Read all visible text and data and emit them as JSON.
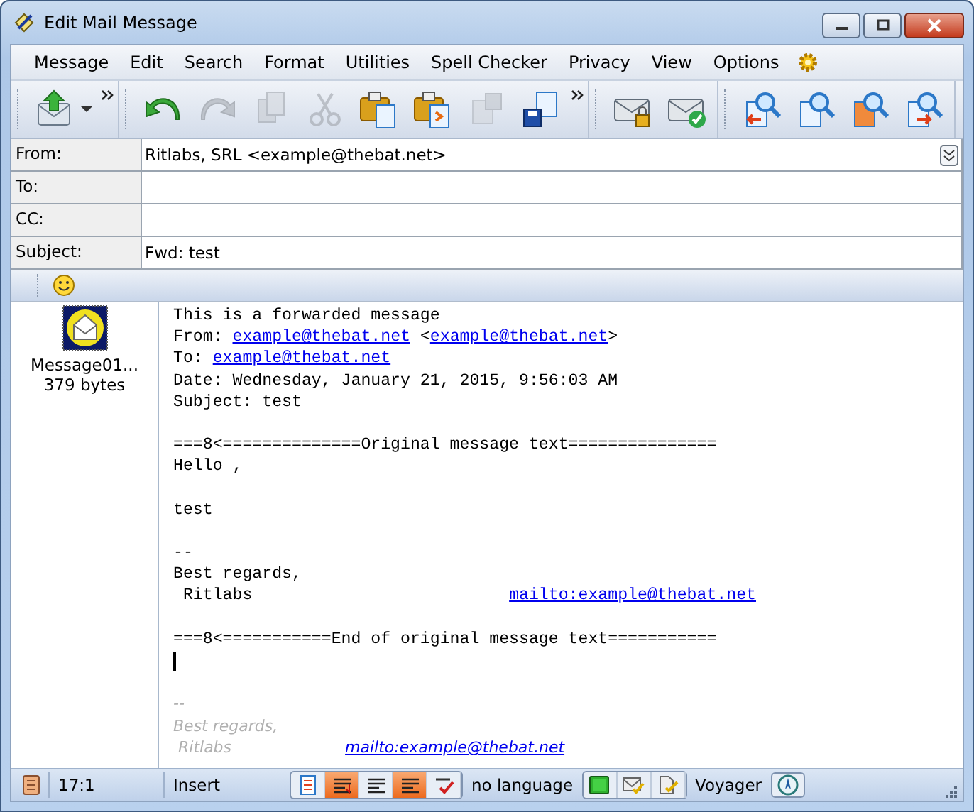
{
  "window": {
    "title": "Edit Mail Message"
  },
  "menu": [
    "Message",
    "Edit",
    "Search",
    "Format",
    "Utilities",
    "Spell Checker",
    "Privacy",
    "View",
    "Options"
  ],
  "toolbar": [
    [
      {
        "kind": "send",
        "disabled": false
      }
    ],
    [
      {
        "kind": "undo",
        "disabled": false
      },
      {
        "kind": "redo",
        "disabled": true
      },
      {
        "kind": "copy",
        "disabled": true
      },
      {
        "kind": "cut",
        "disabled": true
      },
      {
        "kind": "paste",
        "disabled": false
      },
      {
        "kind": "paste-quote",
        "disabled": false
      },
      {
        "kind": "save",
        "disabled": true
      },
      {
        "kind": "save-as",
        "disabled": false
      }
    ],
    [
      {
        "kind": "encrypt",
        "disabled": false
      },
      {
        "kind": "sign",
        "disabled": false
      }
    ],
    [
      {
        "kind": "find-prev",
        "disabled": false
      },
      {
        "kind": "find",
        "disabled": false
      },
      {
        "kind": "find-replace",
        "disabled": false
      },
      {
        "kind": "find-next",
        "disabled": false
      }
    ]
  ],
  "fields": [
    {
      "label": "From:",
      "value": "Ritlabs, SRL <example@thebat.net>"
    },
    {
      "label": "To:"
    },
    {
      "label": "CC:"
    },
    {
      "label": "Subject:",
      "value": "Fwd: test"
    }
  ],
  "attachment": {
    "name": "Message01...",
    "size": "379 bytes"
  },
  "body": [
    {
      "kind": "text",
      "parts": [
        {
          "kind": "text",
          "text": "This is a forwarded message"
        }
      ]
    },
    {
      "kind": "text",
      "parts": [
        {
          "kind": "text",
          "text": "From: "
        },
        {
          "kind": "link",
          "text": "example@thebat.net"
        },
        {
          "kind": "text",
          "text": " <"
        },
        {
          "kind": "link",
          "text": "example@thebat.net"
        },
        {
          "kind": "text",
          "text": ">"
        }
      ]
    },
    {
      "kind": "text",
      "parts": [
        {
          "kind": "text",
          "text": "To: "
        },
        {
          "kind": "link",
          "text": "example@thebat.net"
        }
      ]
    },
    {
      "kind": "text",
      "parts": [
        {
          "kind": "text",
          "text": "Date: Wednesday, January 21, 2015, 9:56:03 AM"
        }
      ]
    },
    {
      "kind": "text",
      "parts": [
        {
          "kind": "text",
          "text": "Subject: test"
        }
      ]
    },
    {
      "kind": "blank"
    },
    {
      "kind": "text",
      "parts": [
        {
          "kind": "text",
          "text": "===8<==============Original message text==============="
        }
      ]
    },
    {
      "kind": "text",
      "parts": [
        {
          "kind": "text",
          "text": "Hello ,"
        }
      ]
    },
    {
      "kind": "blank"
    },
    {
      "kind": "text",
      "parts": [
        {
          "kind": "text",
          "text": "test"
        }
      ]
    },
    {
      "kind": "blank"
    },
    {
      "kind": "text",
      "parts": [
        {
          "kind": "text",
          "text": "--"
        }
      ]
    },
    {
      "kind": "text",
      "parts": [
        {
          "kind": "text",
          "text": "Best regards,"
        }
      ]
    },
    {
      "kind": "text",
      "parts": [
        {
          "kind": "text",
          "text": " Ritlabs                          "
        },
        {
          "kind": "link",
          "text": "mailto:example@thebat.net"
        }
      ]
    },
    {
      "kind": "blank"
    },
    {
      "kind": "text",
      "parts": [
        {
          "kind": "text",
          "text": "===8<===========End of original message text==========="
        }
      ]
    },
    {
      "kind": "cursor"
    },
    {
      "kind": "blank"
    },
    {
      "kind": "signature",
      "parts": [
        {
          "kind": "text",
          "text": "--"
        }
      ]
    },
    {
      "kind": "signature",
      "parts": [
        {
          "kind": "text",
          "text": "Best regards,"
        }
      ]
    },
    {
      "kind": "signature",
      "parts": [
        {
          "kind": "text",
          "text": " Ritlabs"
        },
        {
          "kind": "link",
          "text": "mailto:example@thebat.net"
        }
      ]
    }
  ],
  "status_bar": {
    "position": "17:1",
    "mode": "Insert",
    "format_buttons": [
      {
        "kind": "page",
        "on": false
      },
      {
        "kind": "wrap",
        "on": true
      },
      {
        "kind": "justify",
        "on": false
      },
      {
        "kind": "quote",
        "on": true
      },
      {
        "kind": "spell",
        "on": false
      }
    ],
    "language": "no language",
    "check_buttons": [
      {
        "kind": "square"
      },
      {
        "kind": "envelope-check"
      },
      {
        "kind": "page-check"
      }
    ],
    "engine": "Voyager"
  }
}
